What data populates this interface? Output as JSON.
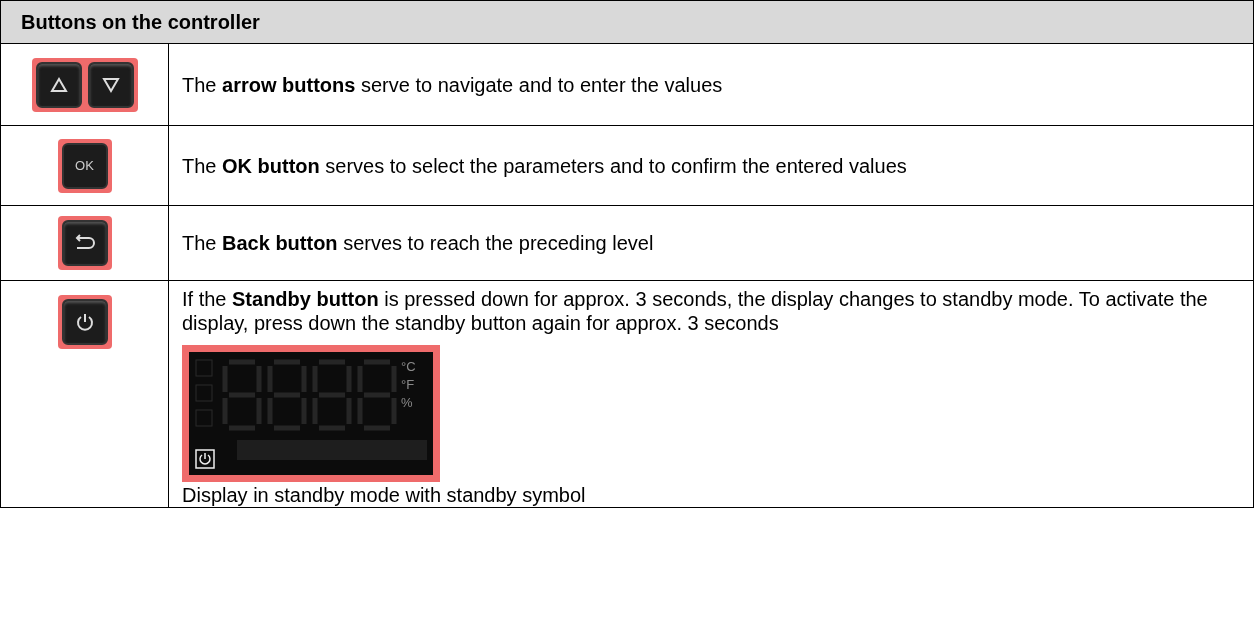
{
  "table": {
    "title": "Buttons on the controller",
    "rows": [
      {
        "kind": "arrows",
        "text": "The **arrow buttons** serve to navigate and to enter the values"
      },
      {
        "kind": "ok",
        "button_label": "OK",
        "text": "The **OK button** serves to select the parameters and to confirm the entered values"
      },
      {
        "kind": "back",
        "text": "The **Back button** serves to reach the preceding level"
      },
      {
        "kind": "standby",
        "text": "If the **Standby button** is pressed down for approx. 3 seconds, the display changes to standby mode. To activate the display, press down the standby button again for approx. 3 seconds",
        "display": {
          "units": [
            "°C",
            "°F",
            "%"
          ]
        },
        "caption": "Display in standby mode with standby symbol"
      }
    ]
  }
}
